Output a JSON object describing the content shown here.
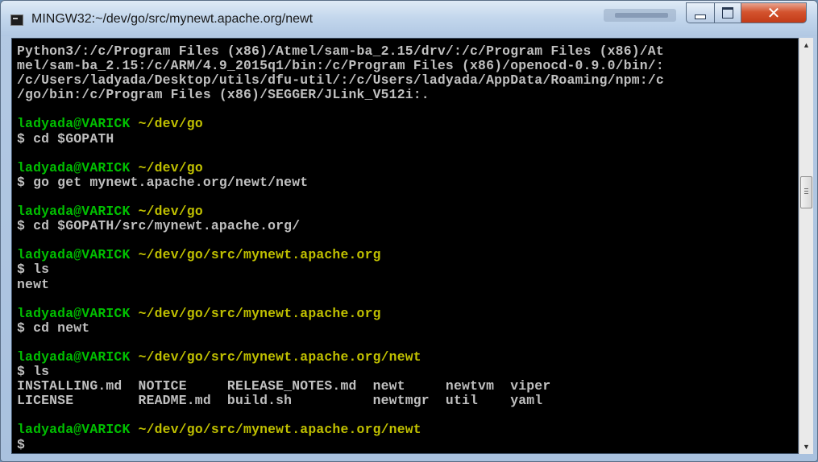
{
  "window": {
    "title": "MINGW32:~/dev/go/src/mynewt.apache.org/newt",
    "controls": {
      "minimize_glyph": "—",
      "maximize_glyph": "□",
      "close_glyph": "✕"
    }
  },
  "terminal": {
    "path_output": [
      "Python3/:/c/Program Files (x86)/Atmel/sam-ba_2.15/drv/:/c/Program Files (x86)/At",
      "mel/sam-ba_2.15:/c/ARM/4.9_2015q1/bin:/c/Program Files (x86)/openocd-0.9.0/bin/:",
      "/c/Users/ladyada/Desktop/utils/dfu-util/:/c/Users/ladyada/AppData/Roaming/npm:/c",
      "/go/bin:/c/Program Files (x86)/SEGGER/JLink_V512i:."
    ],
    "blocks": [
      {
        "user": "ladyada@VARICK",
        "path": "~/dev/go",
        "command": "$ cd $GOPATH",
        "output": []
      },
      {
        "user": "ladyada@VARICK",
        "path": "~/dev/go",
        "command": "$ go get mynewt.apache.org/newt/newt",
        "output": []
      },
      {
        "user": "ladyada@VARICK",
        "path": "~/dev/go",
        "command": "$ cd $GOPATH/src/mynewt.apache.org/",
        "output": []
      },
      {
        "user": "ladyada@VARICK",
        "path": "~/dev/go/src/mynewt.apache.org",
        "command": "$ ls",
        "output": [
          "newt"
        ]
      },
      {
        "user": "ladyada@VARICK",
        "path": "~/dev/go/src/mynewt.apache.org",
        "command": "$ cd newt",
        "output": []
      },
      {
        "user": "ladyada@VARICK",
        "path": "~/dev/go/src/mynewt.apache.org/newt",
        "command": "$ ls",
        "output": [
          "INSTALLING.md  NOTICE     RELEASE_NOTES.md  newt     newtvm  viper",
          "LICENSE        README.md  build.sh          newtmgr  util    yaml"
        ]
      },
      {
        "user": "ladyada@VARICK",
        "path": "~/dev/go/src/mynewt.apache.org/newt",
        "command": "$",
        "output": []
      }
    ]
  },
  "scrollbar": {
    "up_glyph": "▲",
    "down_glyph": "▼"
  },
  "colors": {
    "user_prompt": "#00c000",
    "cwd_path": "#c0c000",
    "text": "#c0c0c0",
    "background": "#000000"
  }
}
